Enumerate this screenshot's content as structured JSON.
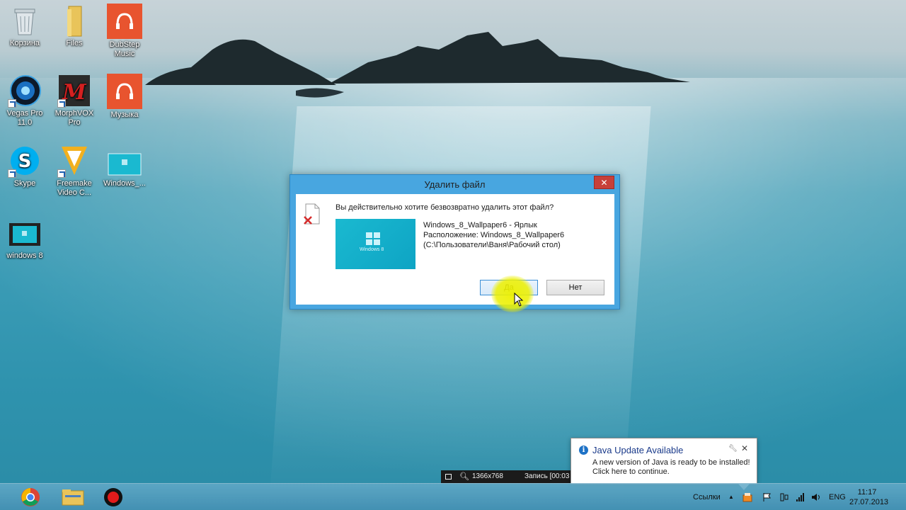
{
  "desktop": {
    "icons": [
      {
        "label": "Корзина"
      },
      {
        "label": "Files"
      },
      {
        "label": "DubStep Music"
      },
      {
        "label": "Vegas Pro 11.0"
      },
      {
        "label": "MorphVOX Pro"
      },
      {
        "label": "Музыка"
      },
      {
        "label": "Skype"
      },
      {
        "label": "Freemake Video C..."
      },
      {
        "label": "Windows_..."
      },
      {
        "label": "windows 8"
      }
    ]
  },
  "dialog": {
    "title": "Удалить файл",
    "close_label": "✕",
    "question": "Вы действительно хотите безвозвратно удалить этот файл?",
    "file_name": "Windows_8_Wallpaper6 - Ярлык",
    "location": "Расположение: Windows_8_Wallpaper6",
    "path": "(C:\\Пользователи\\Ваня\\Рабочий стол)",
    "thumb_text": "Windows 8",
    "yes_label": "Да",
    "no_label": "Нет"
  },
  "recorder": {
    "resolution": "1366x768",
    "record_label": "Запись [00:03"
  },
  "balloon": {
    "title": "Java Update Available",
    "line1": "A new version of Java is ready to be installed!",
    "line2": "Click here to continue."
  },
  "taskbar": {
    "links_label": "Ссылки",
    "language": "ENG",
    "time": "11:17",
    "date": "27.07.2013"
  },
  "colors": {
    "dialog_frame": "#48a6e0",
    "close_button": "#c7403a",
    "tile_orange": "#e8542f"
  }
}
